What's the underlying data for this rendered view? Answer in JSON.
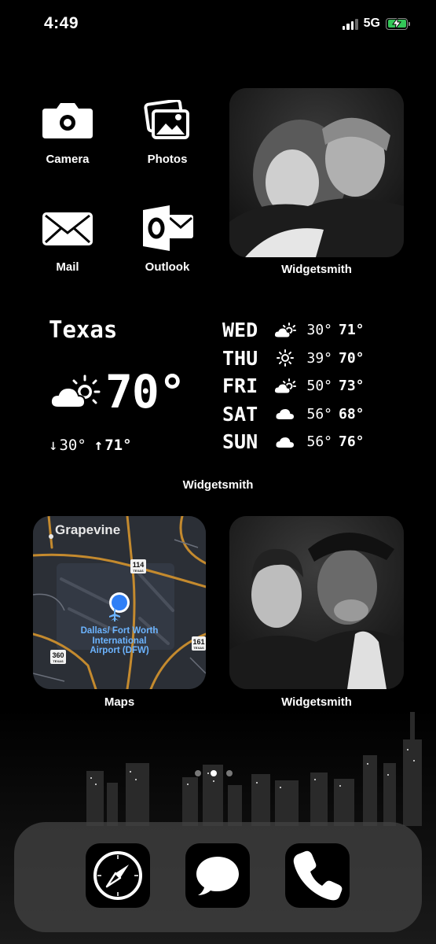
{
  "status_bar": {
    "time": "4:49",
    "network": "5G"
  },
  "apps": {
    "camera": "Camera",
    "photos": "Photos",
    "mail": "Mail",
    "outlook": "Outlook",
    "maps": "Maps"
  },
  "widget_labels": {
    "photo_top": "Widgetsmith",
    "weather": "Widgetsmith",
    "photo_bottom": "Widgetsmith"
  },
  "weather": {
    "location": "Texas",
    "current_temp": "70°",
    "current_icon": "partly-sunny-icon",
    "low": "30°",
    "high": "71°",
    "forecast": [
      {
        "day": "WED",
        "icon": "partly-sunny-icon",
        "low": "30°",
        "high": "71°"
      },
      {
        "day": "THU",
        "icon": "sun-icon",
        "low": "39°",
        "high": "70°"
      },
      {
        "day": "FRI",
        "icon": "partly-sunny-icon",
        "low": "50°",
        "high": "73°"
      },
      {
        "day": "SAT",
        "icon": "cloud-icon",
        "low": "56°",
        "high": "68°"
      },
      {
        "day": "SUN",
        "icon": "cloud-icon",
        "low": "56°",
        "high": "76°"
      }
    ]
  },
  "map": {
    "title": "Grapevine",
    "airport": "Dallas/ Fort Worth International Airport (DFW)",
    "route_114": "114",
    "route_360": "360",
    "route_161": "161",
    "shield_state": "TEXAS"
  },
  "page_dots": {
    "count": 3,
    "active": 2
  },
  "dock": [
    "safari-icon",
    "messages-icon",
    "phone-icon"
  ],
  "colors": {
    "battery": "#34c759",
    "map_pin": "#2f7ff6",
    "map_roads": "#c48a2e",
    "airport_text": "#6cb4ff"
  }
}
